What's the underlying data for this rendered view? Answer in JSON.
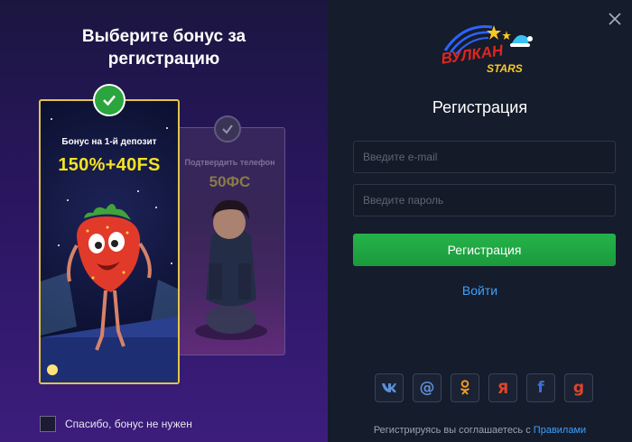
{
  "left": {
    "title_line1": "Выберите бонус за",
    "title_line2": "регистрацию",
    "bonus_cards": [
      {
        "caption": "Бонус на 1-й депозит",
        "value": "150%+40FS",
        "selected": true
      },
      {
        "caption": "Подтвердить телефон",
        "value": "50ФС",
        "selected": false
      }
    ],
    "skip_label": "Спасибо, бонус не нужен"
  },
  "right": {
    "logo_top": "ВУЛКАН",
    "logo_bottom": "STARS",
    "title": "Регистрация",
    "email_placeholder": "Введите e-mail",
    "password_placeholder": "Введите пароль",
    "register_button": "Регистрация",
    "login_link": "Войти",
    "socials": [
      "vk-icon",
      "mail-ru-icon",
      "odnoklassniki-icon",
      "yandex-icon",
      "facebook-icon",
      "google-icon"
    ],
    "terms_text": "Регистрируясь вы соглашаетесь с",
    "terms_link": "Правилами"
  },
  "colors": {
    "accent_green": "#25b34a",
    "link_blue": "#3ea0ff",
    "bonus_yellow": "#f4e322",
    "card_border_gold": "#e0c54a"
  }
}
